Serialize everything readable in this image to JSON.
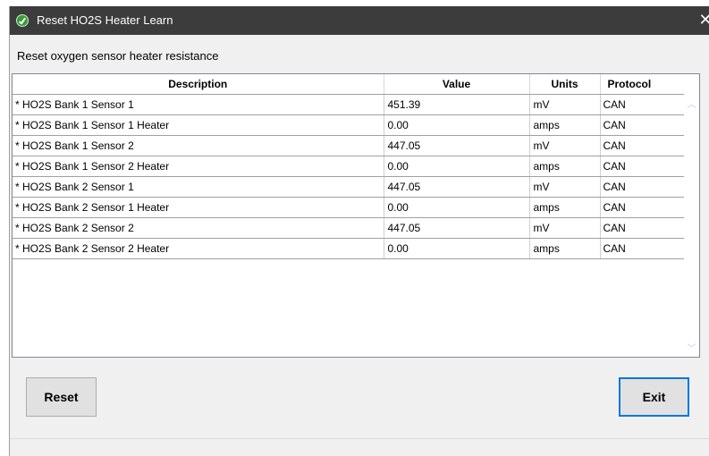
{
  "window": {
    "title": "Reset HO2S Heater Learn",
    "close_glyph": "✕"
  },
  "subtitle": "Reset oxygen sensor heater resistance",
  "table": {
    "columns": [
      "Description",
      "Value",
      "Units",
      "Protocol"
    ],
    "rows": [
      {
        "description": "* HO2S Bank 1 Sensor 1",
        "value": "451.39",
        "units": "mV",
        "protocol": "CAN"
      },
      {
        "description": "* HO2S Bank 1 Sensor 1 Heater",
        "value": "0.00",
        "units": "amps",
        "protocol": "CAN"
      },
      {
        "description": "* HO2S Bank 1 Sensor 2",
        "value": "447.05",
        "units": "mV",
        "protocol": "CAN"
      },
      {
        "description": "* HO2S Bank 1 Sensor 2 Heater",
        "value": "0.00",
        "units": "amps",
        "protocol": "CAN"
      },
      {
        "description": "* HO2S Bank 2 Sensor 1",
        "value": "447.05",
        "units": "mV",
        "protocol": "CAN"
      },
      {
        "description": "* HO2S Bank 2 Sensor 1 Heater",
        "value": "0.00",
        "units": "amps",
        "protocol": "CAN"
      },
      {
        "description": "* HO2S Bank 2 Sensor 2",
        "value": "447.05",
        "units": "mV",
        "protocol": "CAN"
      },
      {
        "description": "* HO2S Bank 2 Sensor 2 Heater",
        "value": "0.00",
        "units": "amps",
        "protocol": "CAN"
      }
    ]
  },
  "buttons": {
    "reset_label": "Reset",
    "exit_label": "Exit"
  },
  "icons": {
    "app": "app-logo-icon",
    "close": "close-icon",
    "scroll_up": "scroll-up-arrow-icon",
    "scroll_down": "scroll-down-arrow-icon"
  },
  "colors": {
    "titlebar": "#3c3c3c",
    "accent_focus": "#0078d7",
    "button_face": "#e1e1e1",
    "window_bg": "#f0f0f0"
  }
}
